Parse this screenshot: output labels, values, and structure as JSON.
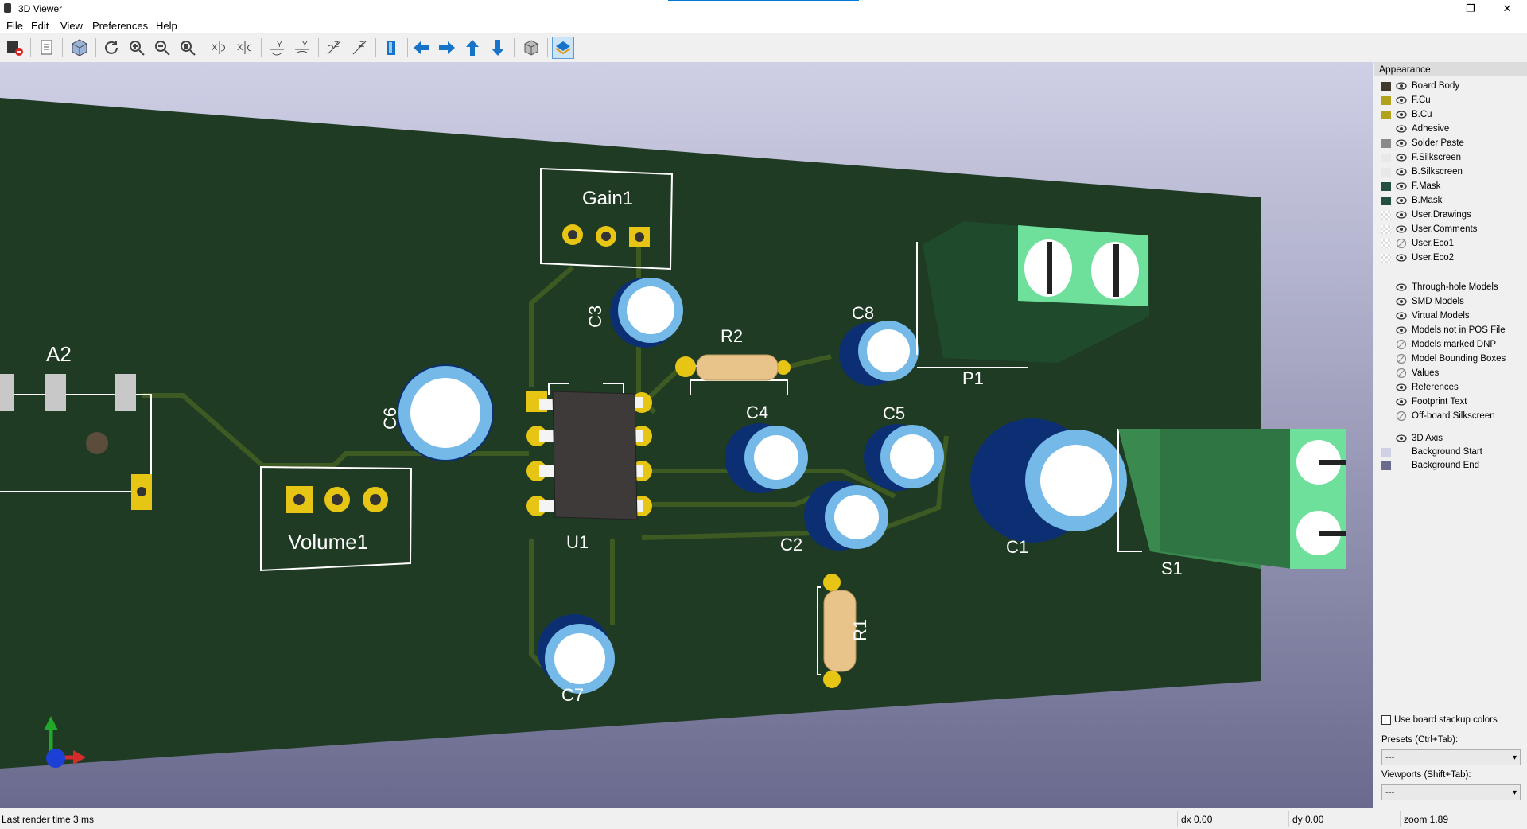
{
  "window": {
    "title": "3D Viewer",
    "minimize": "—",
    "restore": "❐",
    "close": "✕"
  },
  "menu": [
    "File",
    "Edit",
    "View",
    "Preferences",
    "Help"
  ],
  "toolbar": {
    "buttons": [
      "reload-board-icon",
      "copy-image-icon",
      "raytracing-icon",
      "refresh-icon",
      "zoom-in-icon",
      "zoom-out-icon",
      "zoom-fit-icon",
      "rotate-x-cw-icon",
      "rotate-x-ccw-icon",
      "rotate-y-cw-icon",
      "rotate-y-ccw-icon",
      "rotate-z-cw-icon",
      "rotate-z-ccw-icon",
      "flip-board-icon",
      "move-left-icon",
      "move-right-icon",
      "move-up-icon",
      "move-down-icon",
      "ortho-icon",
      "toggle-layers-icon"
    ],
    "arrow_color": "#1673c8"
  },
  "board": {
    "colors": {
      "mask": "#203b24",
      "track": "#3d5a22",
      "pad": "#e7c514",
      "silk": "#ffffff",
      "cap_body": "#0b2f72",
      "cap_top": "#74b9e8",
      "terminal": "#6fe09c",
      "resistor": "#e9c48a"
    },
    "labels": {
      "gain1": "Gain1",
      "volume1": "Volume1",
      "u1": "U1",
      "a2": "A2",
      "c1": "C1",
      "c2": "C2",
      "c3": "C3",
      "c4": "C4",
      "c5": "C5",
      "c6": "C6",
      "c7": "C7",
      "c8": "C8",
      "r1": "R1",
      "r2": "R2",
      "p1": "P1",
      "s1": "S1"
    }
  },
  "appearance": {
    "header": "Appearance",
    "layers": [
      {
        "name": "Board Body",
        "color": "#413a2c"
      },
      {
        "name": "F.Cu",
        "color": "#b0a21c"
      },
      {
        "name": "B.Cu",
        "color": "#b0a21c"
      },
      {
        "name": "Adhesive",
        "color": ""
      },
      {
        "name": "Solder Paste",
        "color": "#8a8a8a"
      },
      {
        "name": "F.Silkscreen",
        "color": "#e8e8e8"
      },
      {
        "name": "B.Silkscreen",
        "color": "#e8e8e8"
      },
      {
        "name": "F.Mask",
        "color": "#245040"
      },
      {
        "name": "B.Mask",
        "color": "#245040"
      },
      {
        "name": "User.Drawings",
        "color": "checker"
      },
      {
        "name": "User.Comments",
        "color": "checker"
      },
      {
        "name": "User.Eco1",
        "color": "checker"
      },
      {
        "name": "User.Eco2",
        "color": "checker"
      }
    ],
    "models": [
      "Through-hole Models",
      "SMD Models",
      "Virtual Models",
      "Models not in POS File",
      "Models marked DNP",
      "Model Bounding Boxes"
    ],
    "extras": [
      "Values",
      "References",
      "Footprint Text",
      "Off-board Silkscreen"
    ],
    "axis": "3D Axis",
    "background": [
      {
        "name": "Background Start",
        "color": "#cfcfe6"
      },
      {
        "name": "Background End",
        "color": "#6b6b8e"
      }
    ],
    "stackup_label": "Use board stackup colors",
    "presets_label": "Presets (Ctrl+Tab):",
    "presets_value": "---",
    "viewports_label": "Viewports (Shift+Tab):",
    "viewports_value": "---"
  },
  "status": {
    "render": "Last render time 3 ms",
    "dx": "dx 0.00",
    "dy": "dy 0.00",
    "zoom": "zoom 1.89"
  }
}
